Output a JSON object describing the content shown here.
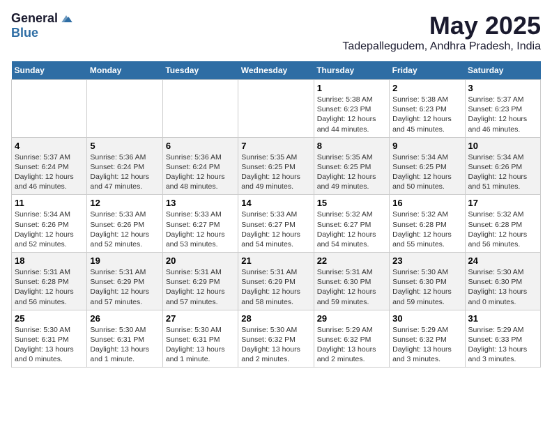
{
  "logo": {
    "general": "General",
    "blue": "Blue"
  },
  "title": "May 2025",
  "location": "Tadepallegudem, Andhra Pradesh, India",
  "weekdays": [
    "Sunday",
    "Monday",
    "Tuesday",
    "Wednesday",
    "Thursday",
    "Friday",
    "Saturday"
  ],
  "weeks": [
    [
      {
        "day": "",
        "info": ""
      },
      {
        "day": "",
        "info": ""
      },
      {
        "day": "",
        "info": ""
      },
      {
        "day": "",
        "info": ""
      },
      {
        "day": "1",
        "info": "Sunrise: 5:38 AM\nSunset: 6:23 PM\nDaylight: 12 hours\nand 44 minutes."
      },
      {
        "day": "2",
        "info": "Sunrise: 5:38 AM\nSunset: 6:23 PM\nDaylight: 12 hours\nand 45 minutes."
      },
      {
        "day": "3",
        "info": "Sunrise: 5:37 AM\nSunset: 6:23 PM\nDaylight: 12 hours\nand 46 minutes."
      }
    ],
    [
      {
        "day": "4",
        "info": "Sunrise: 5:37 AM\nSunset: 6:24 PM\nDaylight: 12 hours\nand 46 minutes."
      },
      {
        "day": "5",
        "info": "Sunrise: 5:36 AM\nSunset: 6:24 PM\nDaylight: 12 hours\nand 47 minutes."
      },
      {
        "day": "6",
        "info": "Sunrise: 5:36 AM\nSunset: 6:24 PM\nDaylight: 12 hours\nand 48 minutes."
      },
      {
        "day": "7",
        "info": "Sunrise: 5:35 AM\nSunset: 6:25 PM\nDaylight: 12 hours\nand 49 minutes."
      },
      {
        "day": "8",
        "info": "Sunrise: 5:35 AM\nSunset: 6:25 PM\nDaylight: 12 hours\nand 49 minutes."
      },
      {
        "day": "9",
        "info": "Sunrise: 5:34 AM\nSunset: 6:25 PM\nDaylight: 12 hours\nand 50 minutes."
      },
      {
        "day": "10",
        "info": "Sunrise: 5:34 AM\nSunset: 6:26 PM\nDaylight: 12 hours\nand 51 minutes."
      }
    ],
    [
      {
        "day": "11",
        "info": "Sunrise: 5:34 AM\nSunset: 6:26 PM\nDaylight: 12 hours\nand 52 minutes."
      },
      {
        "day": "12",
        "info": "Sunrise: 5:33 AM\nSunset: 6:26 PM\nDaylight: 12 hours\nand 52 minutes."
      },
      {
        "day": "13",
        "info": "Sunrise: 5:33 AM\nSunset: 6:27 PM\nDaylight: 12 hours\nand 53 minutes."
      },
      {
        "day": "14",
        "info": "Sunrise: 5:33 AM\nSunset: 6:27 PM\nDaylight: 12 hours\nand 54 minutes."
      },
      {
        "day": "15",
        "info": "Sunrise: 5:32 AM\nSunset: 6:27 PM\nDaylight: 12 hours\nand 54 minutes."
      },
      {
        "day": "16",
        "info": "Sunrise: 5:32 AM\nSunset: 6:28 PM\nDaylight: 12 hours\nand 55 minutes."
      },
      {
        "day": "17",
        "info": "Sunrise: 5:32 AM\nSunset: 6:28 PM\nDaylight: 12 hours\nand 56 minutes."
      }
    ],
    [
      {
        "day": "18",
        "info": "Sunrise: 5:31 AM\nSunset: 6:28 PM\nDaylight: 12 hours\nand 56 minutes."
      },
      {
        "day": "19",
        "info": "Sunrise: 5:31 AM\nSunset: 6:29 PM\nDaylight: 12 hours\nand 57 minutes."
      },
      {
        "day": "20",
        "info": "Sunrise: 5:31 AM\nSunset: 6:29 PM\nDaylight: 12 hours\nand 57 minutes."
      },
      {
        "day": "21",
        "info": "Sunrise: 5:31 AM\nSunset: 6:29 PM\nDaylight: 12 hours\nand 58 minutes."
      },
      {
        "day": "22",
        "info": "Sunrise: 5:31 AM\nSunset: 6:30 PM\nDaylight: 12 hours\nand 59 minutes."
      },
      {
        "day": "23",
        "info": "Sunrise: 5:30 AM\nSunset: 6:30 PM\nDaylight: 12 hours\nand 59 minutes."
      },
      {
        "day": "24",
        "info": "Sunrise: 5:30 AM\nSunset: 6:30 PM\nDaylight: 13 hours\nand 0 minutes."
      }
    ],
    [
      {
        "day": "25",
        "info": "Sunrise: 5:30 AM\nSunset: 6:31 PM\nDaylight: 13 hours\nand 0 minutes."
      },
      {
        "day": "26",
        "info": "Sunrise: 5:30 AM\nSunset: 6:31 PM\nDaylight: 13 hours\nand 1 minute."
      },
      {
        "day": "27",
        "info": "Sunrise: 5:30 AM\nSunset: 6:31 PM\nDaylight: 13 hours\nand 1 minute."
      },
      {
        "day": "28",
        "info": "Sunrise: 5:30 AM\nSunset: 6:32 PM\nDaylight: 13 hours\nand 2 minutes."
      },
      {
        "day": "29",
        "info": "Sunrise: 5:29 AM\nSunset: 6:32 PM\nDaylight: 13 hours\nand 2 minutes."
      },
      {
        "day": "30",
        "info": "Sunrise: 5:29 AM\nSunset: 6:32 PM\nDaylight: 13 hours\nand 3 minutes."
      },
      {
        "day": "31",
        "info": "Sunrise: 5:29 AM\nSunset: 6:33 PM\nDaylight: 13 hours\nand 3 minutes."
      }
    ]
  ]
}
